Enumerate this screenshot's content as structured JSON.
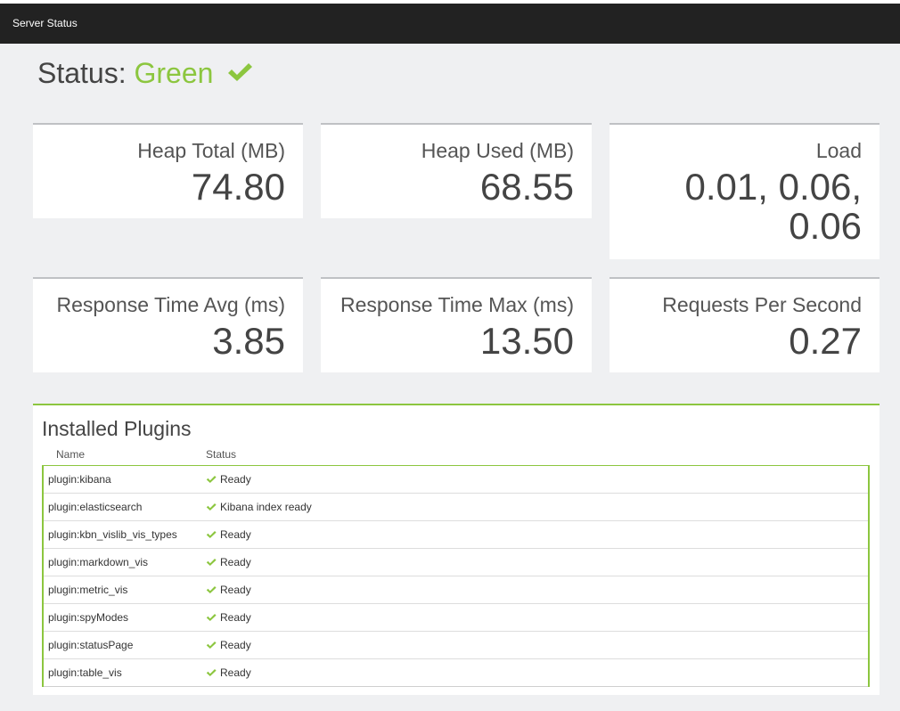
{
  "navbar": {
    "title": "Server Status"
  },
  "status": {
    "label": "Status:",
    "state": "Green",
    "icon": "check-icon",
    "color": "#8cc63f"
  },
  "metrics": [
    {
      "label": "Heap Total (MB)",
      "value": "74.80"
    },
    {
      "label": "Heap Used (MB)",
      "value": "68.55"
    },
    {
      "label": "Load",
      "value": "0.01, 0.06, 0.06"
    },
    {
      "label": "Response Time Avg (ms)",
      "value": "3.85"
    },
    {
      "label": "Response Time Max (ms)",
      "value": "13.50"
    },
    {
      "label": "Requests Per Second",
      "value": "0.27"
    }
  ],
  "plugins": {
    "title": "Installed Plugins",
    "columns": {
      "name": "Name",
      "status": "Status"
    },
    "rows": [
      {
        "name": "plugin:kibana",
        "status": "Ready"
      },
      {
        "name": "plugin:elasticsearch",
        "status": "Kibana index ready"
      },
      {
        "name": "plugin:kbn_vislib_vis_types",
        "status": "Ready"
      },
      {
        "name": "plugin:markdown_vis",
        "status": "Ready"
      },
      {
        "name": "plugin:metric_vis",
        "status": "Ready"
      },
      {
        "name": "plugin:spyModes",
        "status": "Ready"
      },
      {
        "name": "plugin:statusPage",
        "status": "Ready"
      },
      {
        "name": "plugin:table_vis",
        "status": "Ready"
      }
    ]
  }
}
